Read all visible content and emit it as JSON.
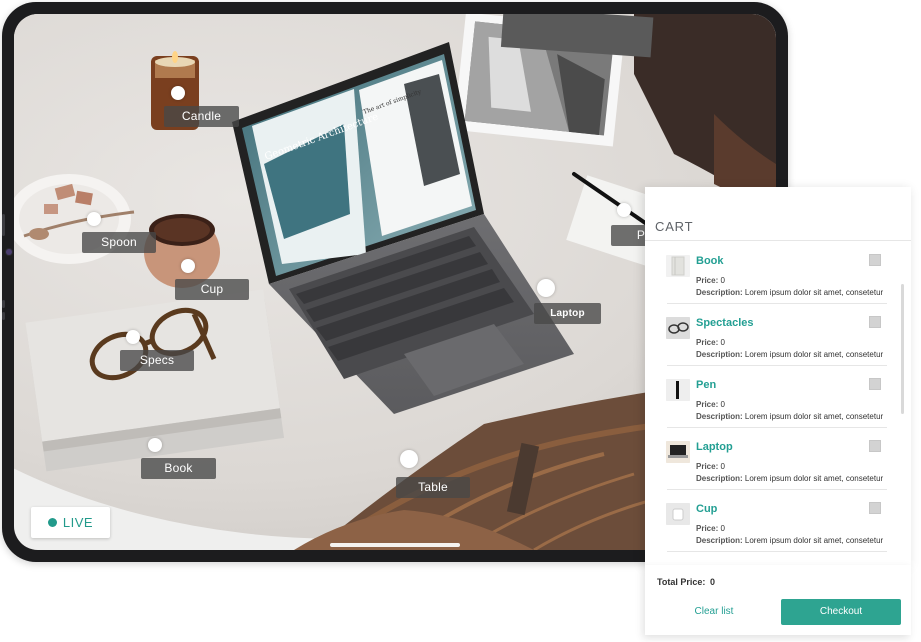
{
  "hotspots": {
    "candle": "Candle",
    "spoon": "Spoon",
    "cup": "Cup",
    "specs": "Specs",
    "book": "Book",
    "laptop": "Laptop",
    "table": "Table",
    "pen": "P"
  },
  "live_label": "LIVE",
  "laptop_screen_text": {
    "title": "Geometric Architecture",
    "subtitle": "The art of simplicity"
  },
  "cart": {
    "title": "CART",
    "price_label": "Price:",
    "description_label": "Description:",
    "items": [
      {
        "name": "Book",
        "price": "0",
        "description": "Lorem ipsum dolor sit amet, consetetur",
        "icon": "book-icon"
      },
      {
        "name": "Spectacles",
        "price": "0",
        "description": "Lorem ipsum dolor sit amet, consetetur",
        "icon": "spectacles-icon"
      },
      {
        "name": "Pen",
        "price": "0",
        "description": "Lorem ipsum dolor sit amet, consetetur",
        "icon": "pen-icon"
      },
      {
        "name": "Laptop",
        "price": "0",
        "description": "Lorem ipsum dolor sit amet, consetetur",
        "icon": "laptop-icon"
      },
      {
        "name": "Cup",
        "price": "0",
        "description": "Lorem ipsum dolor sit amet, consetetur",
        "icon": "cup-icon"
      }
    ],
    "total_label": "Total Price:",
    "total_value": "0",
    "clear_label": "Clear list",
    "checkout_label": "Checkout"
  },
  "colors": {
    "accent": "#2ea491",
    "accent_text": "#239f93",
    "tablet_bezel": "#1c1c1e",
    "label_bg": "#484848"
  }
}
